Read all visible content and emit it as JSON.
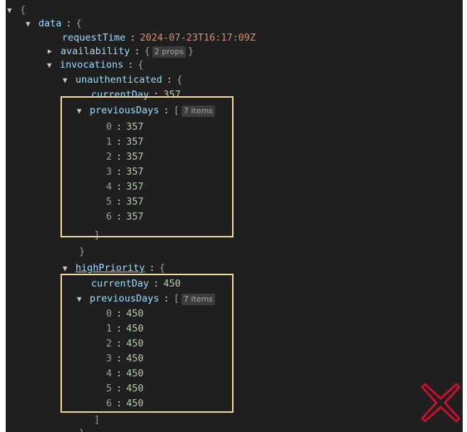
{
  "tree": {
    "root_open": "{",
    "data_key": "data",
    "request_time_key": "requestTime",
    "request_time_value": "2024-07-23T16:17:09Z",
    "availability_key": "availability",
    "availability_badge": "2 props",
    "invocations_key": "invocations",
    "unauthenticated": {
      "key": "unauthenticated",
      "current_day_key": "currentDay",
      "current_day_value": "357",
      "previous_days_key": "previousDays",
      "previous_days_badge": "7 items",
      "items": [
        {
          "index": "0",
          "value": "357"
        },
        {
          "index": "1",
          "value": "357"
        },
        {
          "index": "2",
          "value": "357"
        },
        {
          "index": "3",
          "value": "357"
        },
        {
          "index": "4",
          "value": "357"
        },
        {
          "index": "5",
          "value": "357"
        },
        {
          "index": "6",
          "value": "357"
        }
      ]
    },
    "high_priority": {
      "key": "highPriority",
      "current_day_key": "currentDay",
      "current_day_value": "450",
      "previous_days_key": "previousDays",
      "previous_days_badge": "7 items",
      "items": [
        {
          "index": "0",
          "value": "450"
        },
        {
          "index": "1",
          "value": "450"
        },
        {
          "index": "2",
          "value": "450"
        },
        {
          "index": "3",
          "value": "450"
        },
        {
          "index": "4",
          "value": "450"
        },
        {
          "index": "5",
          "value": "450"
        },
        {
          "index": "6",
          "value": "450"
        }
      ]
    },
    "symbols": {
      "colon": ":",
      "open_brace": "{",
      "close_brace": "}",
      "open_bracket": "[",
      "close_bracket": "]"
    }
  },
  "colors": {
    "background": "#1f1f1f",
    "key": "#9cdcfe",
    "string": "#ce9178",
    "number": "#b5cea8",
    "highlight_box": "#f4dca0",
    "x_mark": "#c8102e"
  },
  "icons": {
    "expand": "triangle-down-icon",
    "collapsed": "triangle-right-icon",
    "annotation": "red-x-mark-icon"
  }
}
